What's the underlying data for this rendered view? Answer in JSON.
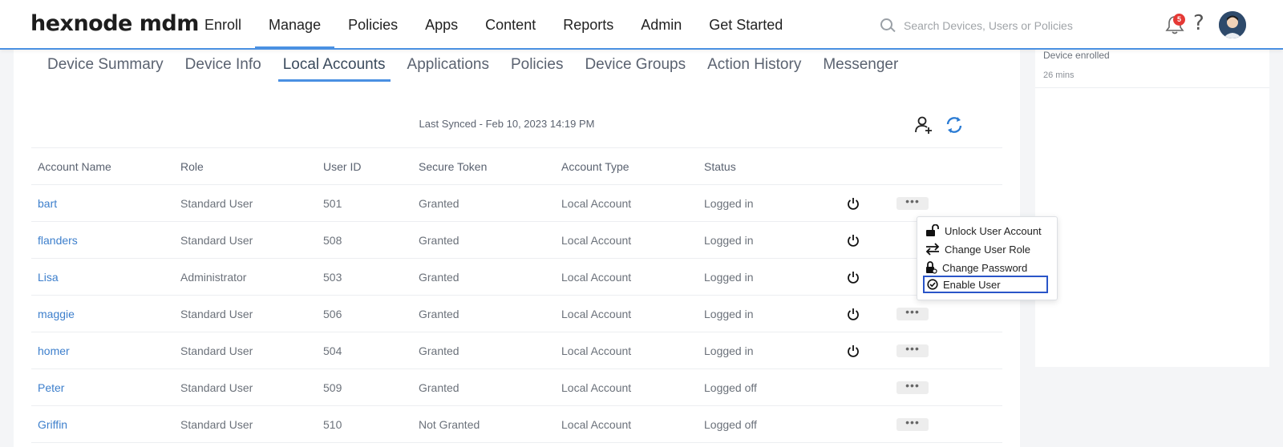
{
  "header": {
    "logo": "hexnode mdm",
    "nav": [
      "Enroll",
      "Manage",
      "Policies",
      "Apps",
      "Content",
      "Reports",
      "Admin",
      "Get Started"
    ],
    "search_placeholder": "Search Devices, Users or Policies",
    "notification_count": "5"
  },
  "subtabs": [
    "Device Summary",
    "Device Info",
    "Local Accounts",
    "Applications",
    "Policies",
    "Device Groups",
    "Action History",
    "Messenger"
  ],
  "sync_text": "Last Synced - Feb 10, 2023 14:19 PM",
  "table": {
    "headers": [
      "Account Name",
      "Role",
      "User ID",
      "Secure Token",
      "Account Type",
      "Status"
    ],
    "rows": [
      [
        "bart",
        "Standard User",
        "501",
        "Granted",
        "Local Account",
        "Logged in"
      ],
      [
        "flanders",
        "Standard User",
        "508",
        "Granted",
        "Local Account",
        "Logged in"
      ],
      [
        "Lisa",
        "Administrator",
        "503",
        "Granted",
        "Local Account",
        "Logged in"
      ],
      [
        "maggie",
        "Standard User",
        "506",
        "Granted",
        "Local Account",
        "Logged in"
      ],
      [
        "homer",
        "Standard User",
        "504",
        "Granted",
        "Local Account",
        "Logged in"
      ],
      [
        "Peter",
        "Standard User",
        "509",
        "Granted",
        "Local Account",
        "Logged off"
      ],
      [
        "Griffin",
        "Standard User",
        "510",
        "Not Granted",
        "Local Account",
        "Logged off"
      ]
    ]
  },
  "menu": {
    "items": [
      "Unlock User Account",
      "Change User Role",
      "Change Password",
      "Enable User"
    ]
  },
  "side": {
    "title": "Device enrolled",
    "time": "26 mins"
  }
}
